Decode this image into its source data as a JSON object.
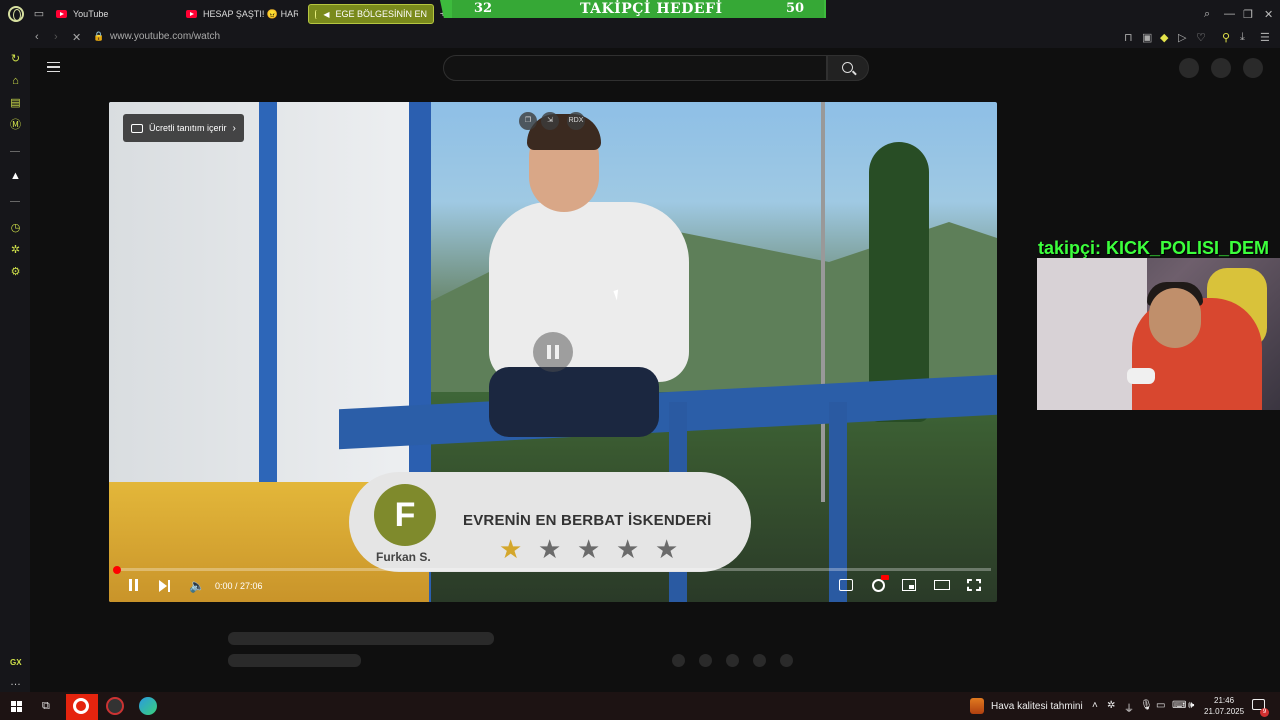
{
  "browser": {
    "tabs": [
      {
        "label": "YouTube"
      },
      {
        "label": "HESAP ŞAŞTI! 😠 HARCA"
      },
      {
        "label": "EGE BÖLGESİNİN EN"
      }
    ],
    "url": "www.youtube.com/watch",
    "sidebar_badge": "GX"
  },
  "follow_goal": {
    "title": "TAKİPÇİ HEDEFİ",
    "current": "32",
    "target": "50",
    "bar_color": "#3dbb3d"
  },
  "video": {
    "paid_promo_label": "Ücretli tanıtım içerir",
    "overlay_badge": "RDX",
    "time": "0:00 / 27:06",
    "progress": 0.0,
    "review": {
      "avatar_letter": "F",
      "author": "Furkan S.",
      "text": "EVRENİN EN BERBAT İSKENDERİ",
      "rating": 1,
      "max_rating": 5,
      "star_color": "#d4a72c"
    }
  },
  "stream": {
    "follower_label": "takipçi: KICK_POLISI_DEM",
    "follower_color": "#3cff3c"
  },
  "taskbar": {
    "weather": "Hava kalitesi tahmini",
    "time": "21:46",
    "date": "21.07.2025",
    "notification_count": "9"
  },
  "icons": {
    "search": "search-icon",
    "menu": "hamburger-menu-icon",
    "back": "back-arrow-icon",
    "forward": "forward-arrow-icon"
  }
}
